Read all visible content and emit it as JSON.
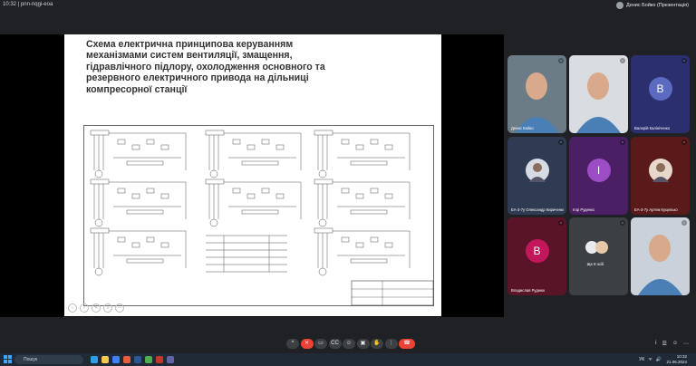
{
  "topbar": {
    "time": "10:32",
    "meeting_code": "pnn-nqgi-eoa",
    "presenter_label": "Денис Бойко (Презентація)"
  },
  "slide": {
    "title_lines": [
      "Схема  електрична принципова керуванням",
      "механізмами систем вентиляції, змащення,",
      "гідравлічного підлору, охолодження основного та",
      "резервного електричного привода   на дільниці",
      "компресорної станції"
    ]
  },
  "participants": [
    {
      "name": "Денис Бойко",
      "type": "video",
      "bg": "#6b7c86"
    },
    {
      "name": "",
      "type": "video",
      "bg": "#d9dde2"
    },
    {
      "name": "Валерій Калініченко",
      "type": "avatar",
      "initial": "В",
      "bg": "#2b2f6e",
      "avatar_bg": "#5c6bc0"
    },
    {
      "name": "ЕА-3-7у Олександр Кириченко",
      "type": "photo",
      "bg": "#2f3b52",
      "avatar_bg": "#d6dbe3"
    },
    {
      "name": "Ігор Руденко",
      "type": "avatar",
      "initial": "І",
      "bg": "#4a1f63",
      "avatar_bg": "#9c4cc4"
    },
    {
      "name": "ЕА-3-7у Артем Куцилько",
      "type": "photo",
      "bg": "#5a1a1a",
      "avatar_bg": "#e8d7cb"
    },
    {
      "name": "Владислав Руднюк",
      "type": "avatar",
      "initial": "В",
      "bg": "#5a1428",
      "avatar_bg": "#c2185b"
    },
    {
      "name": "Ще 8 осіб",
      "type": "group",
      "bg": "#3c4043"
    },
    {
      "name": "",
      "type": "video",
      "bg": "#c9d2da"
    }
  ],
  "controls": {
    "buttons": [
      {
        "label": "^",
        "icon": "chevron-up-icon",
        "style": "dark"
      },
      {
        "label": "✕",
        "icon": "mic-off-icon",
        "style": "red"
      },
      {
        "label": "▭",
        "icon": "camera-icon",
        "style": "dark"
      },
      {
        "label": "CC",
        "icon": "captions-icon",
        "style": "dark"
      },
      {
        "label": "☺",
        "icon": "emoji-icon",
        "style": "dark"
      },
      {
        "label": "▣",
        "icon": "present-icon",
        "style": "dark"
      },
      {
        "label": "✋",
        "icon": "raise-hand-icon",
        "style": "dark"
      },
      {
        "label": "⋮",
        "icon": "more-options-icon",
        "style": "dark"
      },
      {
        "label": "☎",
        "icon": "end-call-icon",
        "style": "end"
      }
    ],
    "right_icons": [
      "i",
      "☰",
      "☺",
      "⋯"
    ]
  },
  "taskbar": {
    "search_placeholder": "Пошук",
    "clock_time": "10:32",
    "clock_date": "21.06.2024",
    "tray": [
      "УК",
      "ᯤ",
      "🔊"
    ],
    "apps": [
      {
        "icon": "edge-icon",
        "color": "#2ea0e8"
      },
      {
        "icon": "explorer-icon",
        "color": "#f2c94c"
      },
      {
        "icon": "store-icon",
        "color": "#3b82f6"
      },
      {
        "icon": "chrome-icon",
        "color": "#e85d3a"
      },
      {
        "icon": "word-icon",
        "color": "#2b5797"
      },
      {
        "icon": "photos-icon",
        "color": "#4caf50"
      },
      {
        "icon": "media-icon",
        "color": "#c0392b"
      },
      {
        "icon": "teams-icon",
        "color": "#6264a7"
      }
    ]
  }
}
